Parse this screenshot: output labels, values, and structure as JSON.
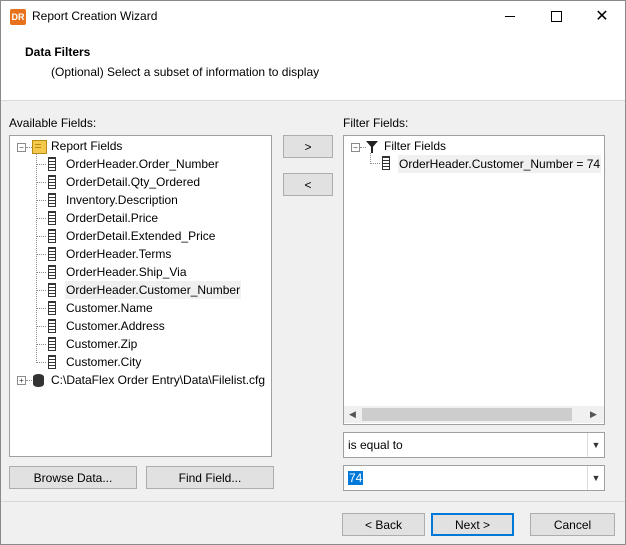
{
  "window": {
    "title": "Report Creation Wizard",
    "app_icon": "DR"
  },
  "header": {
    "title": "Data Filters",
    "subtitle": "(Optional) Select a subset of information to display"
  },
  "available": {
    "label": "Available Fields:",
    "root": "Report Fields",
    "fields": [
      "OrderHeader.Order_Number",
      "OrderDetail.Qty_Ordered",
      "Inventory.Description",
      "OrderDetail.Price",
      "OrderDetail.Extended_Price",
      "OrderHeader.Terms",
      "OrderHeader.Ship_Via",
      "OrderHeader.Customer_Number",
      "Customer.Name",
      "Customer.Address",
      "Customer.Zip",
      "Customer.City"
    ],
    "selected_index": 7,
    "datasource": "C:\\DataFlex Order Entry\\Data\\Filelist.cfg"
  },
  "transfer": {
    "add_label": ">",
    "remove_label": "<"
  },
  "filter": {
    "label": "Filter Fields:",
    "root": "Filter Fields",
    "items": [
      "OrderHeader.Customer_Number = 74"
    ]
  },
  "operator": {
    "value": "is equal to"
  },
  "value_combo": {
    "value": "74"
  },
  "buttons": {
    "browse": "Browse Data...",
    "find": "Find Field...",
    "back": "< Back",
    "next": "Next >",
    "cancel": "Cancel"
  }
}
